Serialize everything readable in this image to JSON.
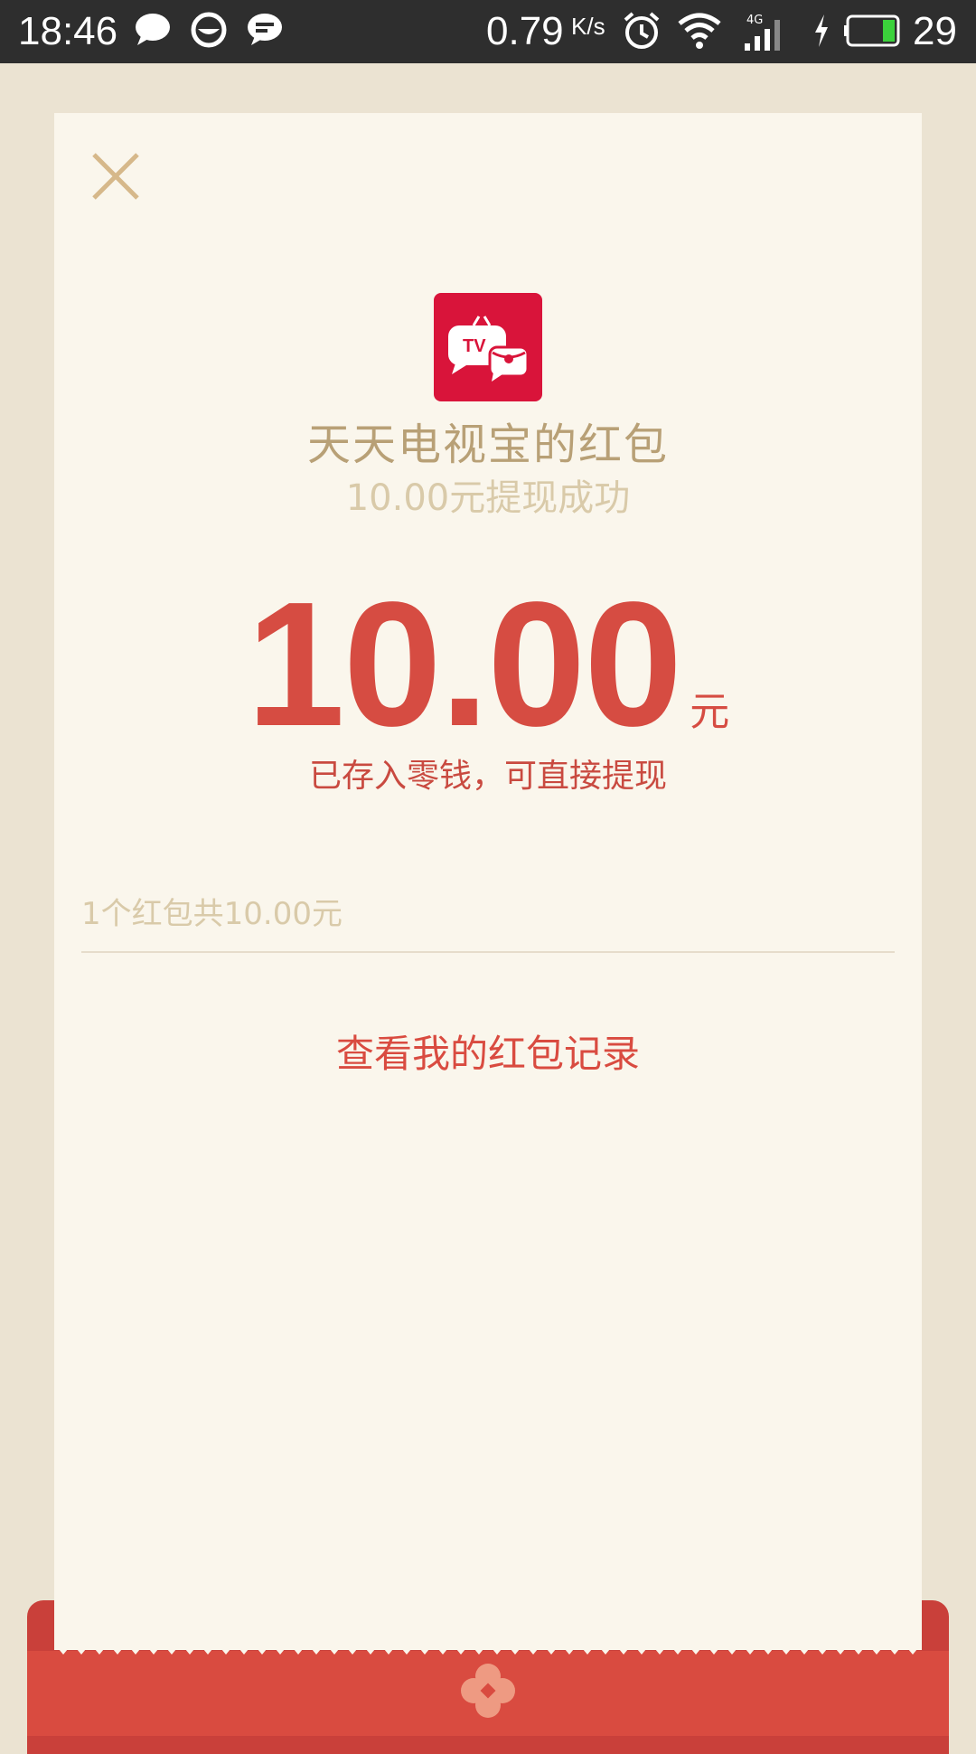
{
  "status_bar": {
    "time": "18:46",
    "network_speed": "0.79",
    "network_speed_unit": "K/s",
    "signal_type": "4G",
    "battery_level": "29",
    "icons": [
      "chat-bubble-icon",
      "smiley-icon",
      "message-icon",
      "alarm-icon",
      "wifi-icon",
      "signal-icon",
      "charging-icon",
      "battery-icon"
    ]
  },
  "card": {
    "sender_name": "天天电视宝的红包",
    "subtitle": "10.00元提现成功",
    "logo_text": "TV",
    "amount": "10.00",
    "amount_unit": "元",
    "deposit_note": "已存入零钱，可直接提现",
    "summary": "1个红包共10.00元",
    "records_link": "查看我的红包记录"
  },
  "colors": {
    "accent_red": "#d64c42",
    "gold_text": "#b8a076",
    "light_gold": "#d9caa9",
    "card_background": "#faf6ec",
    "page_background": "#ebe3d2",
    "logo_red": "#d9143a"
  }
}
